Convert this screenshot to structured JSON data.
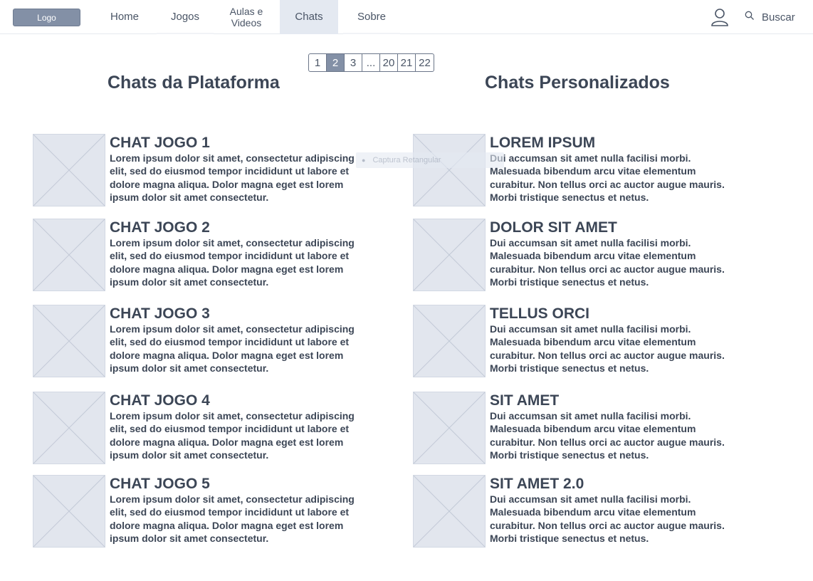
{
  "header": {
    "logo": "Logo",
    "nav": {
      "home": "Home",
      "jogos": "Jogos",
      "aulas": "Aulas e\nVideos",
      "chats": "Chats",
      "sobre": "Sobre"
    },
    "active_nav": "Chats",
    "search_label": "Buscar",
    "icons": {
      "user": "user-icon",
      "search": "search-icon"
    }
  },
  "pagination": {
    "pages": [
      "1",
      "2",
      "3",
      "...",
      "20",
      "21",
      "22"
    ],
    "current": "2"
  },
  "sections": {
    "left_title": "Chats da Plataforma",
    "right_title": "Chats Personalizados"
  },
  "left_cards": [
    {
      "title": "CHAT JOGO 1",
      "desc": "Lorem ipsum dolor sit amet, consectetur adipiscing elit, sed do eiusmod tempor incididunt ut labore et dolore magna aliqua. Dolor magna eget est lorem ipsum dolor sit amet consectetur."
    },
    {
      "title": "CHAT JOGO 2",
      "desc": "Lorem ipsum dolor sit amet, consectetur adipiscing elit, sed do eiusmod tempor incididunt ut labore et dolore magna aliqua. Dolor magna eget est lorem ipsum dolor sit amet consectetur."
    },
    {
      "title": "CHAT JOGO 3",
      "desc": "Lorem ipsum dolor sit amet, consectetur adipiscing elit, sed do eiusmod tempor incididunt ut labore et dolore magna aliqua. Dolor magna eget est lorem ipsum dolor sit amet consectetur."
    },
    {
      "title": "CHAT JOGO 4",
      "desc": "Lorem ipsum dolor sit amet, consectetur adipiscing elit, sed do eiusmod tempor incididunt ut labore et dolore magna aliqua. Dolor magna eget est lorem ipsum dolor sit amet consectetur."
    },
    {
      "title": "CHAT JOGO 5",
      "desc": "Lorem ipsum dolor sit amet, consectetur adipiscing elit, sed do eiusmod tempor incididunt ut labore et dolore magna aliqua. Dolor magna eget est lorem ipsum dolor sit amet consectetur."
    }
  ],
  "right_cards": [
    {
      "title": "LOREM IPSUM",
      "desc": "Dui accumsan sit amet nulla facilisi morbi. Malesuada bibendum arcu vitae elementum curabitur. Non tellus orci ac auctor augue mauris. Morbi tristique senectus et netus."
    },
    {
      "title": "DOLOR SIT AMET",
      "desc": "Dui accumsan sit amet nulla facilisi morbi. Malesuada bibendum arcu vitae elementum curabitur. Non tellus orci ac auctor augue mauris. Morbi tristique senectus et netus."
    },
    {
      "title": "TELLUS ORCI",
      "desc": "Dui accumsan sit amet nulla facilisi morbi. Malesuada bibendum arcu vitae elementum curabitur. Non tellus orci ac auctor augue mauris. Morbi tristique senectus et netus."
    },
    {
      "title": "SIT AMET",
      "desc": "Dui accumsan sit amet nulla facilisi morbi. Malesuada bibendum arcu vitae elementum curabitur. Non tellus orci ac auctor augue mauris. Morbi tristique senectus et netus."
    },
    {
      "title": "SIT AMET 2.0",
      "desc": "Dui accumsan sit amet nulla facilisi morbi. Malesuada bibendum arcu vitae elementum curabitur. Non tellus orci ac auctor augue mauris. Morbi tristique senectus et netus."
    }
  ],
  "overlay": {
    "label": "Captura Retangular"
  },
  "colors": {
    "accent": "#8390a6",
    "active_tab_bg": "#e4e9f1",
    "text": "#3c4656",
    "placeholder": "#e2e6ee"
  }
}
